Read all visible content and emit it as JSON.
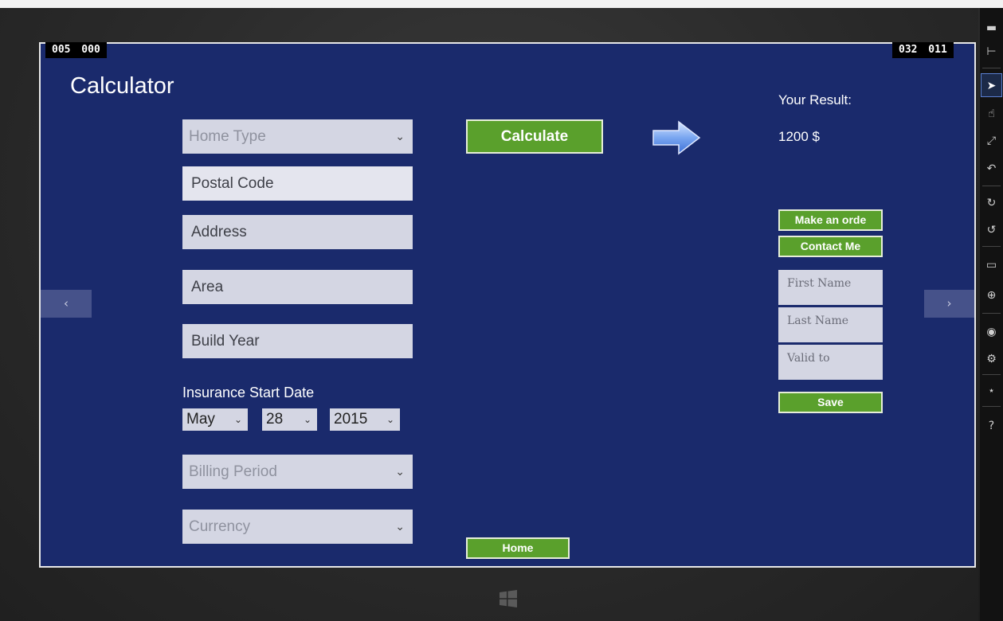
{
  "counters": {
    "left": "005 000",
    "right": "032 011"
  },
  "app": {
    "title": "Calculator"
  },
  "form": {
    "home_type_placeholder": "Home Type",
    "postal_code": "Postal Code",
    "address": "Address",
    "area": "Area",
    "build_year": "Build Year",
    "start_date_label": "Insurance Start Date",
    "month": "May",
    "day": "28",
    "year": "2015",
    "billing_period_placeholder": "Billing Period",
    "currency_placeholder": "Currency"
  },
  "actions": {
    "calculate": "Calculate",
    "home": "Home"
  },
  "result": {
    "label": "Your Result:",
    "value": "1200 $",
    "make_order": "Make an orde",
    "contact_me": "Contact Me",
    "first_name": "First Name",
    "last_name": "Last Name",
    "valid_to": "Valid to",
    "save": "Save"
  },
  "nav": {
    "prev_icon": "chevron-left",
    "next_icon": "chevron-right"
  },
  "charms": [
    "minimize",
    "pin",
    "pointer",
    "touch",
    "pinch",
    "rotate",
    "rotate-cw",
    "rotate-ccw",
    "monitor",
    "globe",
    "camera",
    "settings",
    "network",
    "help"
  ],
  "colors": {
    "screen_bg": "#1a2a6c",
    "button_green": "#5aa02c",
    "field_bg": "#d4d6e3"
  }
}
